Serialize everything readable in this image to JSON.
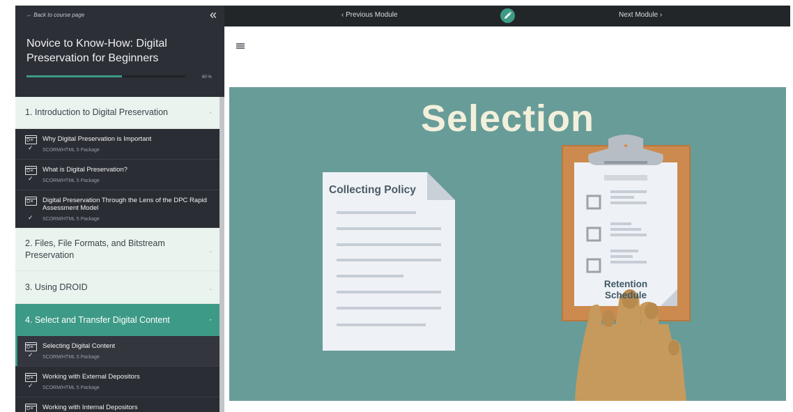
{
  "sidebar": {
    "back_link": "← Back to course page",
    "collapse_icon": "«",
    "course_title": "Novice to Know-How: Digital Preservation for Beginners",
    "progress": {
      "value": 60,
      "label": "60 %"
    },
    "modules": [
      {
        "title": "1. Introduction to Digital Preservation",
        "expanded": true,
        "active": false,
        "chevron": "⌃",
        "lessons": [
          {
            "title": "Why Digital Preservation is Important",
            "type": "SCORM/HTML 5 Package",
            "check": "✓",
            "icon": "scorm-package-icon"
          },
          {
            "title": "What is Digital Preservation?",
            "type": "SCORM/HTML 5 Package",
            "check": "✓",
            "icon": "scorm-package-icon"
          },
          {
            "title": "Digital Preservation Through the Lens of the DPC Rapid Assessment Model",
            "type": "SCORM/HTML 5 Package",
            "check": "✓",
            "icon": "scorm-package-icon"
          }
        ]
      },
      {
        "title": "2. Files, File Formats, and Bitstream Preservation",
        "expanded": false,
        "active": false,
        "chevron": "⌄"
      },
      {
        "title": "3. Using DROID",
        "expanded": false,
        "active": false,
        "chevron": "⌄"
      },
      {
        "title": "4. Select and Transfer Digital Content",
        "expanded": true,
        "active": true,
        "chevron": "⌃",
        "lessons": [
          {
            "title": "Selecting Digital Content",
            "type": "SCORM/HTML 5 Package",
            "check": "✓",
            "icon": "scorm-package-icon",
            "current": true
          },
          {
            "title": "Working with External Depositors",
            "type": "SCORM/HTML 5 Package",
            "check": "✓",
            "icon": "scorm-package-icon"
          },
          {
            "title": "Working with Internal Depositors",
            "type": "",
            "check": "",
            "icon": "scorm-package-icon"
          }
        ]
      }
    ]
  },
  "topbar": {
    "prev_label": "‹ Previous Module",
    "next_label": "Next Module ›",
    "edit_icon": "pencil-icon"
  },
  "content": {
    "menu_icon": "hamburger-icon",
    "slide": {
      "title": "Selection",
      "document_label": "Collecting Policy",
      "clipboard_label_line1": "Retention",
      "clipboard_label_line2": "Schedule"
    }
  },
  "colors": {
    "accent": "#3c9a86",
    "sidebar_bg": "#2a2d33",
    "module_bg": "#eaf4ef",
    "slide_bg": "#689c98",
    "title_cream": "#f2f0dc",
    "clipboard_board": "#cc8a4e",
    "clip_grey": "#b7bdc4",
    "skin": "#c69a5c"
  }
}
